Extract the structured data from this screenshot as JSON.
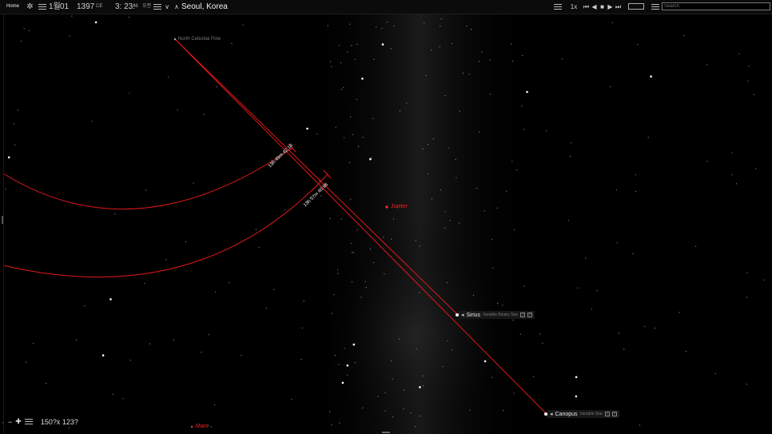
{
  "topbar": {
    "home_label": "Home",
    "month": "1월",
    "day": "01",
    "year": "1397",
    "era": "CE",
    "time_hm": "3: 23:",
    "time_s": "46",
    "time_suffix": "오전",
    "location": "Seoul, Korea",
    "speed": "1x",
    "search_placeholder": "Search"
  },
  "sky": {
    "north_pole_label": "North Celestial Pole",
    "ra_label_1": "13h 49m 42.16",
    "ra_label_2": "13h 57m 40.96",
    "jupiter_label": "Jupiter",
    "mars_label": "Mars",
    "sirius": {
      "name": "Sirius",
      "type": "Variable Binary Star"
    },
    "canopus": {
      "name": "Canopus",
      "type": "Variable Star"
    }
  },
  "zoom": {
    "field_of_view": "150?x 123?"
  },
  "colors": {
    "guide_line": "#e01818",
    "background": "#000000"
  }
}
